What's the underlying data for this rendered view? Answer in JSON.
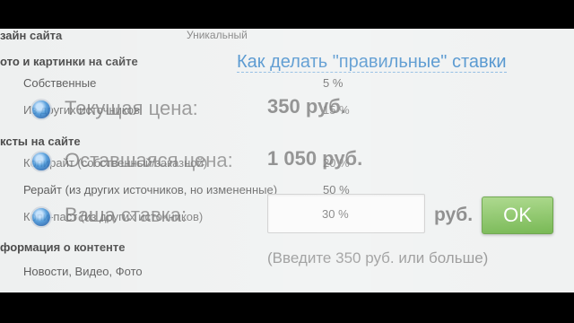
{
  "table": {
    "design_label": "зайн сайта",
    "design_value": "Уникальный",
    "photos_section": "ото и картинки на сайте",
    "own_label": "Собственные",
    "own_value": "5 %",
    "other_label": "Из других источников",
    "other_value": "15 %",
    "texts_section": "ксты на сайте",
    "copyright_label": "Копирайт (собственный/заказной)",
    "copyright_value": "20 %",
    "rewrite_label": "Рерайт (из других источников, но измененные)",
    "rewrite_value": "50 %",
    "copypaste_label": "Копи-паст (из других источников)",
    "info_section": "формация о контенте",
    "news_label": "Новости, Видео, Фото"
  },
  "bid": {
    "link_text": "Как делать \"правильные\" ставки",
    "current_price_label": "Текущая цена:",
    "current_price_value": "350 руб.",
    "remaining_price_label": "Оставшаяся цена:",
    "remaining_price_value": "1 050 руб.",
    "your_bid_label": "Ваша ставка:",
    "input_value": "30 %",
    "currency": "руб.",
    "ok_label": "OK",
    "hint": "(Введите 350 руб. или больше)"
  }
}
